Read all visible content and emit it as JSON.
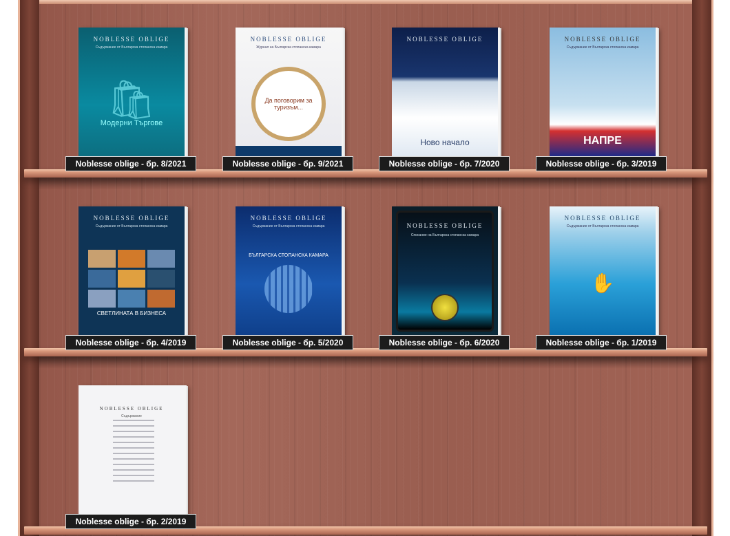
{
  "brand": "NOBLESSE OBLIGE",
  "books": [
    {
      "label": "Noblesse oblige - бр. 8/2021",
      "subtitle": "Съдържание от Българска стопанска камара",
      "cover_text": "Модерни Търгове",
      "icon": "shopping-bags-icon"
    },
    {
      "label": "Noblesse oblige - бр. 9/2021",
      "subtitle": "Журнал на Българска стопанска камара",
      "cover_text": "Да поговорим за туризъм...",
      "icon": "globe-landmarks-icon"
    },
    {
      "label": "Noblesse oblige - бр. 7/2020",
      "subtitle": "",
      "cover_text": "Ново начало",
      "icon": "mountain-icon"
    },
    {
      "label": "Noblesse oblige - бр. 3/2019",
      "subtitle": "Съдържание от Българска стопанска камара",
      "cover_text": "НАПРЕ",
      "icon": "ladder-boy-icon"
    },
    {
      "label": "Noblesse oblige - бр. 4/2019",
      "subtitle": "Съдържание от Българска стопанска камара",
      "cover_text": "СВЕТЛИНАТА В БИЗНЕСА",
      "icon": "photo-grid-icon"
    },
    {
      "label": "Noblesse oblige - бр. 5/2020",
      "subtitle": "Съдържание от Българска стопанска камара",
      "cover_text": "БЪЛГАРСКА СТОПАНСКА КАМАРА",
      "icon": "pixel-sphere-icon"
    },
    {
      "label": "Noblesse oblige - бр. 6/2020",
      "subtitle": "Списание на Българска стопанска камара",
      "cover_text": "",
      "icon": "tablet-power-icon"
    },
    {
      "label": "Noblesse oblige - бр. 1/2019",
      "subtitle": "Съдържание от Българска стопанска камара",
      "cover_text": "",
      "icon": "hand-sparkler-icon"
    },
    {
      "label": "Noblesse oblige - бр. 2/2019",
      "subtitle": "Съдържание",
      "cover_text": "",
      "icon": "contents-page-icon"
    }
  ],
  "colors": {
    "label_bg": "#1c1c1c",
    "shelf": "#d9987c",
    "wood": "#9a5e50"
  }
}
